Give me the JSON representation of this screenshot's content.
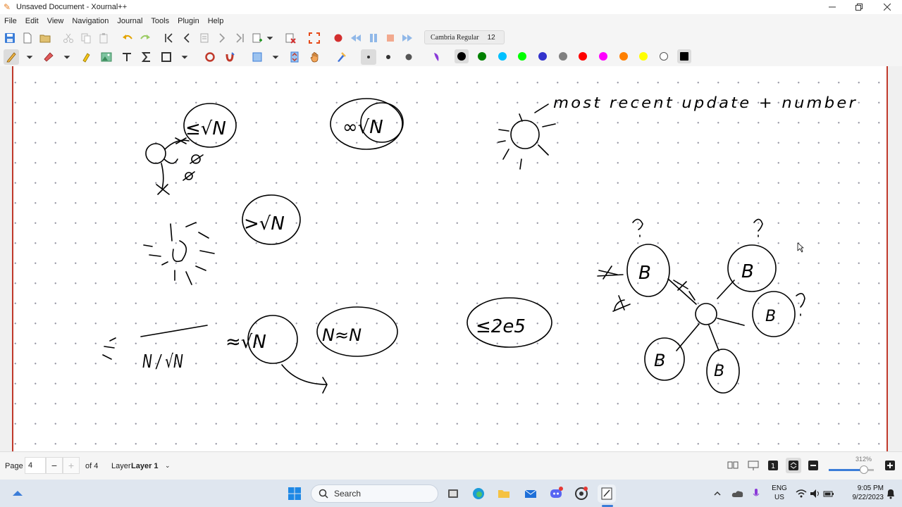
{
  "window": {
    "title": "Unsaved Document - Xournal++",
    "minimize_icon": "minimize-icon",
    "restore_icon": "restore-icon",
    "close_icon": "close-icon"
  },
  "menu": {
    "items": [
      "File",
      "Edit",
      "View",
      "Navigation",
      "Journal",
      "Tools",
      "Plugin",
      "Help"
    ]
  },
  "toolbar_main": {
    "font_name": "Cambria Regular",
    "font_size": "12",
    "icons": [
      "save-icon",
      "new-icon",
      "open-icon",
      "cut-icon",
      "copy-icon",
      "paste-icon",
      "undo-icon",
      "redo-icon",
      "first-page-icon",
      "previous-page-icon",
      "goto-page-icon",
      "next-page-icon",
      "last-page-icon",
      "new-page-icon",
      "new-page-dropdown-icon",
      "delete-page-icon",
      "fullscreen-icon",
      "record-icon",
      "rewind-icon",
      "pause-icon",
      "stop-icon",
      "forward-icon"
    ]
  },
  "toolbar_tools": {
    "icons": [
      "pen-icon",
      "pen-dropdown-icon",
      "eraser-icon",
      "eraser-dropdown-icon",
      "highlighter-icon",
      "image-icon",
      "text-icon",
      "latex-icon",
      "shape-icon",
      "shape-dropdown-icon",
      "ruler-icon",
      "magnet-icon",
      "select-rect-icon",
      "select-dropdown-icon",
      "vertical-space-icon",
      "hand-icon",
      "play-object-icon",
      "thin-stroke-icon",
      "medium-stroke-icon",
      "thick-stroke-icon",
      "fill-icon"
    ],
    "colors": [
      {
        "name": "black",
        "hex": "#000000"
      },
      {
        "name": "green",
        "hex": "#008000"
      },
      {
        "name": "light-blue",
        "hex": "#00c0ff"
      },
      {
        "name": "light-green",
        "hex": "#00ff00"
      },
      {
        "name": "blue",
        "hex": "#3333cc"
      },
      {
        "name": "gray",
        "hex": "#808080"
      },
      {
        "name": "red",
        "hex": "#ff0000"
      },
      {
        "name": "magenta",
        "hex": "#ff00ff"
      },
      {
        "name": "orange",
        "hex": "#ff8000"
      },
      {
        "name": "yellow",
        "hex": "#ffff00"
      },
      {
        "name": "white",
        "hex": "#ffffff"
      },
      {
        "name": "current",
        "hex": "#000000"
      }
    ]
  },
  "canvas": {
    "page_border_color": "#c0392b",
    "handwriting_note": "most recent update + number",
    "circle_labels": [
      "≤√N",
      "∞√N",
      ">√N",
      "≈√N",
      "N≈N",
      "≤2e5",
      "B",
      "B",
      "B",
      "B",
      "B"
    ],
    "fraction": "N / √N",
    "question_marks": [
      "?",
      "?",
      "?"
    ]
  },
  "status": {
    "page_label": "Page",
    "page_value": "4",
    "page_count": "of 4",
    "layer_label": "Layer",
    "layer_value": "Layer 1",
    "zoom": "312%"
  },
  "taskbar": {
    "search_placeholder": "Search",
    "language": "ENG",
    "region": "US",
    "time": "9:05 PM",
    "date": "9/22/2023",
    "apps": [
      "windows-start-icon",
      "file-explorer-icon",
      "edge-icon",
      "folder-icon",
      "mail-icon",
      "discord-icon",
      "chrome-icon",
      "xournalpp-icon"
    ]
  }
}
